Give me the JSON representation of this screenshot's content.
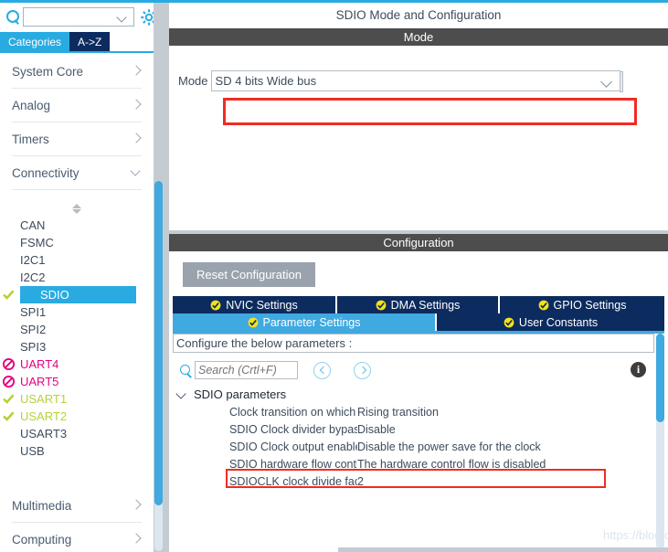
{
  "colors": {
    "accent_blue": "#29abe2",
    "tab_navy": "#0c2b5e",
    "tab_active_blue": "#3fa9e0",
    "section_header_gray": "#4d4d4d",
    "highlight_red": "#f22b22",
    "ok_green": "#b5d334",
    "blocked_magenta": "#e6007e",
    "panel_gray": "#c4ccd2"
  },
  "sidebar": {
    "search": {
      "value": "",
      "placeholder": ""
    },
    "icons": {
      "search": "search-icon",
      "dropdown": "chevron-down-icon",
      "settings": "gear-icon"
    },
    "tabs": [
      {
        "label": "Categories",
        "active": true
      },
      {
        "label": "A->Z",
        "active": false
      }
    ],
    "categories": [
      {
        "label": "System Core",
        "expanded": false
      },
      {
        "label": "Analog",
        "expanded": false
      },
      {
        "label": "Timers",
        "expanded": false
      },
      {
        "label": "Connectivity",
        "expanded": true
      }
    ],
    "categories_bottom": [
      {
        "label": "Multimedia",
        "expanded": false
      },
      {
        "label": "Computing",
        "expanded": false
      }
    ],
    "peripherals": [
      {
        "label": "CAN",
        "state": "none",
        "selected": false
      },
      {
        "label": "FSMC",
        "state": "none",
        "selected": false
      },
      {
        "label": "I2C1",
        "state": "none",
        "selected": false
      },
      {
        "label": "I2C2",
        "state": "none",
        "selected": false
      },
      {
        "label": "SDIO",
        "state": "ok",
        "selected": true
      },
      {
        "label": "SPI1",
        "state": "none",
        "selected": false
      },
      {
        "label": "SPI2",
        "state": "none",
        "selected": false
      },
      {
        "label": "SPI3",
        "state": "none",
        "selected": false
      },
      {
        "label": "UART4",
        "state": "blocked",
        "selected": false
      },
      {
        "label": "UART5",
        "state": "blocked",
        "selected": false
      },
      {
        "label": "USART1",
        "state": "ok",
        "selected": false
      },
      {
        "label": "USART2",
        "state": "ok",
        "selected": false
      },
      {
        "label": "USART3",
        "state": "none",
        "selected": false
      },
      {
        "label": "USB",
        "state": "none",
        "selected": false
      }
    ]
  },
  "main": {
    "panel_title": "SDIO Mode and Configuration",
    "mode_section": {
      "header": "Mode",
      "field_label": "Mode",
      "selected_value": "SD 4 bits Wide bus",
      "highlighted": true
    },
    "configuration_section": {
      "header": "Configuration",
      "reset_button": "Reset Configuration",
      "tabs_row1": [
        {
          "label": "NVIC Settings",
          "active": false
        },
        {
          "label": "DMA Settings",
          "active": false
        },
        {
          "label": "GPIO Settings",
          "active": false
        }
      ],
      "tabs_row2": [
        {
          "label": "Parameter Settings",
          "active": true
        },
        {
          "label": "User Constants",
          "active": false
        }
      ],
      "configure_hint": "Configure the below parameters :",
      "search": {
        "value": "",
        "placeholder": "Search (Crtl+F)"
      },
      "info_glyph": "i",
      "group_label": "SDIO parameters",
      "parameters": [
        {
          "name": "Clock transition on which the bit...",
          "value": "Rising transition",
          "highlighted": false
        },
        {
          "name": "SDIO Clock divider bypass",
          "value": "Disable",
          "highlighted": false
        },
        {
          "name": "SDIO Clock output enable when...",
          "value": "Disable the power save for the clock",
          "highlighted": false
        },
        {
          "name": "SDIO hardware flow control",
          "value": "The hardware control flow is disabled",
          "highlighted": false
        },
        {
          "name": "SDIOCLK clock divide factor",
          "value": "2",
          "highlighted": true
        }
      ]
    }
  },
  "watermark": {
    "text": "https://blog.csdn.net/Deheng_Kong"
  }
}
